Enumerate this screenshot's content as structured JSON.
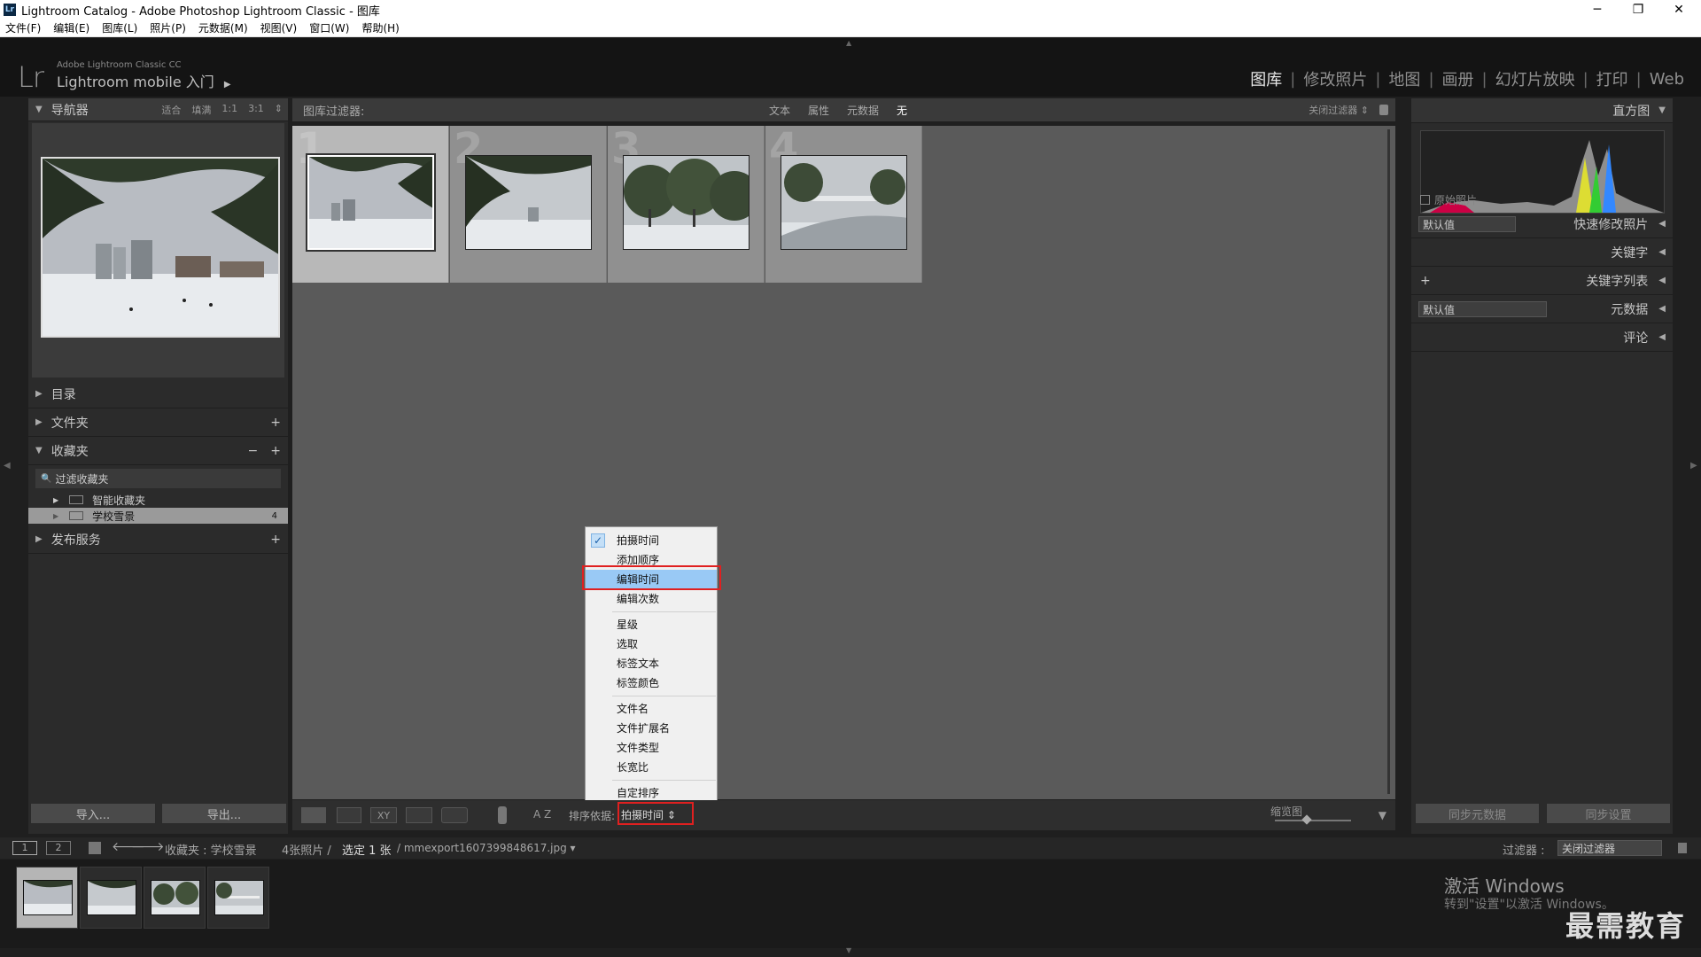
{
  "window": {
    "title": "Lightroom Catalog - Adobe Photoshop Lightroom Classic - 图库",
    "minimize": "─",
    "maximize": "❐",
    "close": "✕"
  },
  "menu": [
    "文件(F)",
    "编辑(E)",
    "图库(L)",
    "照片(P)",
    "元数据(M)",
    "视图(V)",
    "窗口(W)",
    "帮助(H)"
  ],
  "identity": {
    "logo": "Lr",
    "line1": "Adobe Lightroom Classic CC",
    "line2": "Lightroom mobile 入门",
    "arrow": "▶"
  },
  "modules": [
    "图库",
    "修改照片",
    "地图",
    "画册",
    "幻灯片放映",
    "打印",
    "Web"
  ],
  "module_separator": "|",
  "navigator": {
    "title": "导航器",
    "zoom": [
      "适合",
      "填满",
      "1:1",
      "3:1"
    ],
    "zoom_arrow": "⇕"
  },
  "left_sections": {
    "catalog": "目录",
    "folders": "文件夹",
    "collections": "收藏夹",
    "filter_placeholder": "过滤收藏夹",
    "smart_collections": "智能收藏夹",
    "school_snow": "学校雪景",
    "school_snow_count": "4",
    "publish": "发布服务",
    "plus": "+",
    "minus": "−"
  },
  "left_buttons": {
    "import": "导入...",
    "export": "导出..."
  },
  "filter_bar": {
    "label": "图库过滤器:",
    "tabs": [
      "文本",
      "属性",
      "元数据",
      "无"
    ],
    "off": "关闭过滤器 ⇕"
  },
  "grid_numbers": [
    "1",
    "2",
    "3",
    "4"
  ],
  "sort_menu": {
    "groups": [
      [
        "拍摄时间",
        "添加顺序",
        "编辑时间",
        "编辑次数"
      ],
      [
        "星级",
        "选取",
        "标签文本",
        "标签颜色"
      ],
      [
        "文件名",
        "文件扩展名",
        "文件类型",
        "长宽比"
      ],
      [
        "自定排序"
      ]
    ],
    "checked": "拍摄时间",
    "highlighted": "编辑时间",
    "check_mark": "✓"
  },
  "toolbar": {
    "sort_label": "排序依据:",
    "sort_value": "拍摄时间 ⇕",
    "az": "A Z",
    "thumb_label": "缩览图"
  },
  "right_panel": {
    "histogram": "直方图",
    "original_photo": "原始照片",
    "preset_default": "默认值",
    "quick_develop": "快速修改照片",
    "keywording": "关键字",
    "keyword_list": "关键字列表",
    "metadata_default": "默认值",
    "metadata": "元数据",
    "comments": "评论",
    "plus": "+"
  },
  "right_buttons": {
    "sync_metadata": "同步元数据",
    "sync_settings": "同步设置"
  },
  "filmbar": {
    "screen1": "1",
    "screen2": "2",
    "source": "收藏夹 : 学校雪景",
    "count": "4张照片 /",
    "selected": "选定 1 张",
    "filename": "/ mmexport1607399848617.jpg ▾",
    "filter_label": "过滤器 :",
    "filter_value": "关闭过滤器"
  },
  "watermark": {
    "line1": "激活 Windows",
    "line2": "转到\"设置\"以激活 Windows。",
    "brand": "最需教育"
  },
  "colors": {
    "highlight": "#99c9f5",
    "redbox": "#e02020",
    "bg": "#1f1f1f"
  }
}
